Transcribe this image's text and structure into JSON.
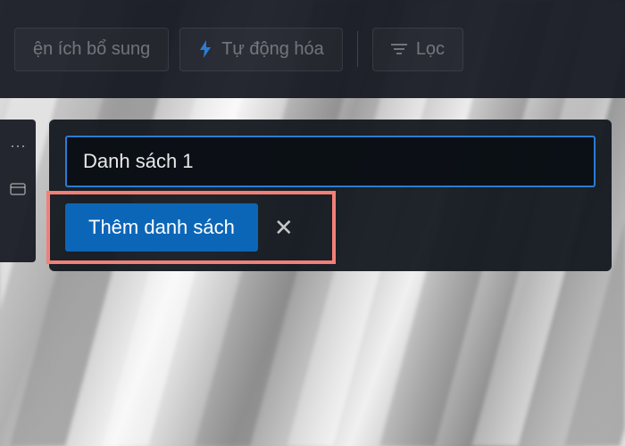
{
  "toolbar": {
    "extensions_label": "ện ích bổ sung",
    "automation_label": "Tự động hóa",
    "filter_label": "Lọc"
  },
  "card": {
    "input_value": "Danh sách 1",
    "add_button_label": "Thêm danh sách"
  }
}
